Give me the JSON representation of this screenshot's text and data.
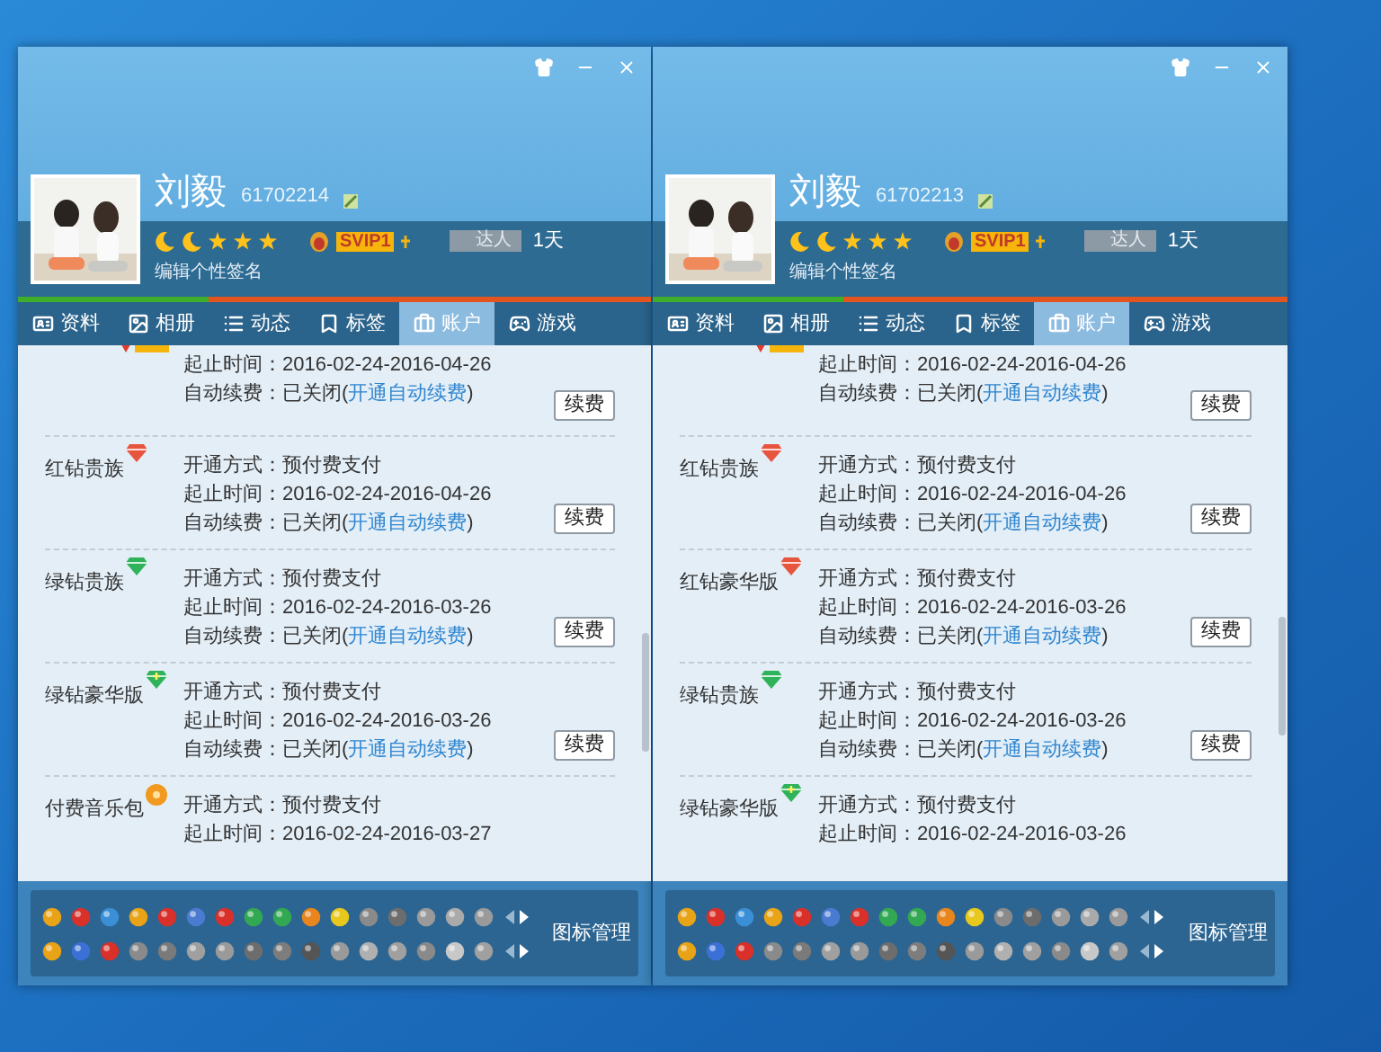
{
  "windows": [
    {
      "name": "刘毅",
      "number": "61702214",
      "vip": "SVIP1",
      "talent": "达人",
      "days": "1天",
      "signature": "编辑个性签名",
      "tabs": [
        {
          "label": "资料",
          "selected": false
        },
        {
          "label": "相册",
          "selected": false
        },
        {
          "label": "动态",
          "selected": false
        },
        {
          "label": "标签",
          "selected": false
        },
        {
          "label": "账户",
          "selected": true
        },
        {
          "label": "游戏",
          "selected": false
        }
      ],
      "services": [
        {
          "kind": "svip",
          "lines": [
            {
              "label": "起止时间：",
              "value": "2016-02-24-2016-04-26"
            },
            {
              "label": "自动续费：",
              "value": "已关闭(",
              "link": "开通自动续费",
              "tail": ")"
            }
          ],
          "button": "续费"
        },
        {
          "name": "红钻贵族",
          "kind": "red-gem",
          "lines": [
            {
              "label": "开通方式：",
              "value": "预付费支付"
            },
            {
              "label": "起止时间：",
              "value": "2016-02-24-2016-04-26"
            },
            {
              "label": "自动续费：",
              "value": "已关闭(",
              "link": "开通自动续费",
              "tail": ")"
            }
          ],
          "button": "续费"
        },
        {
          "name": "绿钻贵族",
          "kind": "green-gem",
          "lines": [
            {
              "label": "开通方式：",
              "value": "预付费支付"
            },
            {
              "label": "起止时间：",
              "value": "2016-02-24-2016-03-26"
            },
            {
              "label": "自动续费：",
              "value": "已关闭(",
              "link": "开通自动续费",
              "tail": ")"
            }
          ],
          "button": "续费"
        },
        {
          "name": "绿钻豪华版",
          "kind": "green-plus-gem",
          "lines": [
            {
              "label": "开通方式：",
              "value": "预付费支付"
            },
            {
              "label": "起止时间：",
              "value": "2016-02-24-2016-03-26"
            },
            {
              "label": "自动续费：",
              "value": "已关闭(",
              "link": "开通自动续费",
              "tail": ")"
            }
          ],
          "button": "续费"
        },
        {
          "name": "付费音乐包",
          "kind": "music",
          "lines": [
            {
              "label": "开通方式：",
              "value": "预付费支付"
            },
            {
              "label": "起止时间：",
              "value": "2016-02-24-2016-03-27"
            }
          ]
        }
      ],
      "icon_manager": "图标管理"
    },
    {
      "name": "刘毅",
      "number": "61702213",
      "vip": "SVIP1",
      "talent": "达人",
      "days": "1天",
      "signature": "编辑个性签名",
      "tabs": [
        {
          "label": "资料",
          "selected": false
        },
        {
          "label": "相册",
          "selected": false
        },
        {
          "label": "动态",
          "selected": false
        },
        {
          "label": "标签",
          "selected": false
        },
        {
          "label": "账户",
          "selected": true
        },
        {
          "label": "游戏",
          "selected": false
        }
      ],
      "services": [
        {
          "kind": "svip",
          "lines": [
            {
              "label": "起止时间：",
              "value": "2016-02-24-2016-04-26"
            },
            {
              "label": "自动续费：",
              "value": "已关闭(",
              "link": "开通自动续费",
              "tail": ")"
            }
          ],
          "button": "续费"
        },
        {
          "name": "红钻贵族",
          "kind": "red-gem",
          "lines": [
            {
              "label": "开通方式：",
              "value": "预付费支付"
            },
            {
              "label": "起止时间：",
              "value": "2016-02-24-2016-04-26"
            },
            {
              "label": "自动续费：",
              "value": "已关闭(",
              "link": "开通自动续费",
              "tail": ")"
            }
          ],
          "button": "续费"
        },
        {
          "name": "红钻豪华版",
          "kind": "red-gem",
          "lines": [
            {
              "label": "开通方式：",
              "value": "预付费支付"
            },
            {
              "label": "起止时间：",
              "value": "2016-02-24-2016-03-26"
            },
            {
              "label": "自动续费：",
              "value": "已关闭(",
              "link": "开通自动续费",
              "tail": ")"
            }
          ],
          "button": "续费"
        },
        {
          "name": "绿钻贵族",
          "kind": "green-gem",
          "lines": [
            {
              "label": "开通方式：",
              "value": "预付费支付"
            },
            {
              "label": "起止时间：",
              "value": "2016-02-24-2016-03-26"
            },
            {
              "label": "自动续费：",
              "value": "已关闭(",
              "link": "开通自动续费",
              "tail": ")"
            }
          ],
          "button": "续费"
        },
        {
          "name": "绿钻豪华版",
          "kind": "green-plus-gem",
          "lines": [
            {
              "label": "开通方式：",
              "value": "预付费支付"
            },
            {
              "label": "起止时间：",
              "value": "2016-02-24-2016-03-26"
            }
          ]
        }
      ],
      "icon_manager": "图标管理"
    }
  ]
}
